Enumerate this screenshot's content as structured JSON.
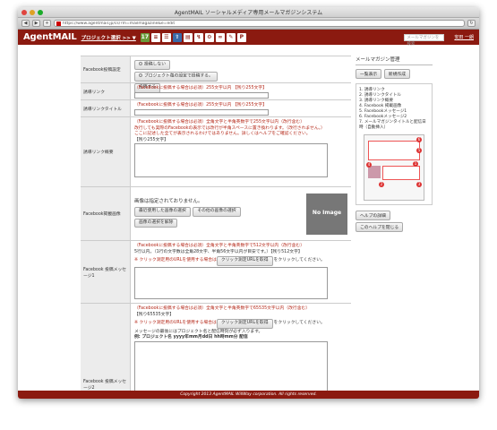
{
  "window": {
    "title": "AgentMAIL ソーシャルメディア専用メールマガジンシステム"
  },
  "browser": {
    "url": "https://www.agentmail.jp/cs/?m=mailmagazine&e=edit"
  },
  "header": {
    "logo": "AgentMAIL",
    "project_select": "プロジェクト選択 >> ▼",
    "icons": [
      "calendar-icon",
      "document-icon",
      "list-icon",
      "upload-icon",
      "book-icon",
      "pin-icon",
      "gear-icon",
      "link-icon",
      "tool-icon",
      "p-icon"
    ],
    "search_placeholder": "メールマガジンを検索",
    "user": "安田 一朗"
  },
  "form": {
    "fb_post": {
      "label": "Facebook投稿設定",
      "options": [
        "投稿しない",
        "プロジェクト毎の設定で投稿する。"
      ],
      "submit": "投稿する"
    },
    "link": {
      "label": "誘導リンク",
      "note": "（Facebookに投稿する場合は必須）255文字以内 【残り255文字】"
    },
    "link_title": {
      "label": "誘導リンクタイトル",
      "note": "（Facebookに投稿する場合は必須）255文字以内 【残り255文字】"
    },
    "link_summary": {
      "label": "誘導リンク概要",
      "note1": "（Facebookに投稿する場合は必須）全角文字と半角英数字で255文字以内（改行含む）",
      "note2": "改行しても実際のFacebookの表示では改行が半角スペースに置き換わります。（改行されません。）",
      "note3": "ここに記述した全てが表示されるわけではありません。詳しくはヘルプをご確認ください。",
      "remain": "【残り255文字】"
    },
    "image": {
      "label": "Facebook掲載画像",
      "status": "画像は指定されておりません。",
      "btn_recent": "最近使用した画像の選択",
      "btn_other": "その他の画像の選択",
      "btn_clear": "画像の選択を解除",
      "placeholder": "No Image"
    },
    "msg1": {
      "label": "Facebook 投稿メッセージ1",
      "note1": "（Facebookに投稿する場合は必須）全角文字と半角英数字で512文字以内（改行含む）",
      "note2": "5行以内。（1行の文字数は全角28文字、半角56文字以内が目安です。）【残り512文字】",
      "note3": "※ クリック測定用のURLを使用する場合は",
      "btn": "クリック測定URLを取得",
      "note4": "をクリックしてください。"
    },
    "msg2": {
      "label": "Facebook 投稿メッセージ2",
      "note1": "（Facebookに投稿する場合は必須）全角文字と半角英数字で65535文字以内（改行含む）",
      "remain": "【残り65535文字】",
      "note3": "※ クリック測定用のURLを使用する場合は",
      "btn": "クリック測定URLを取得",
      "note4": "をクリックしてください。",
      "note5": "メッセージの最後にはプロジェクト名と配信時刻が必ず入ります。",
      "example": "例: プロジェクト名 yyyy年mm月dd日 hh時mm分 配信"
    }
  },
  "side": {
    "title": "メールマガジン管理",
    "btn_list": "一覧表示",
    "btn_new": "新規作成",
    "help_items": [
      "1. 誘導リンク",
      "2. 誘導リンクタイトル",
      "3. 誘導リンク概要",
      "4. Facebook 掲載画像",
      "5. Facebookメッセージ1",
      "6. Facebookメッセージ2",
      "7. メールマガジンタイトルと配信日時（自動挿入）"
    ],
    "btn_help": "ヘルプの詳細",
    "btn_close": "このヘルプを閉じる"
  },
  "footer": {
    "copyright": "Copyright 2013 AgentMAIL WillWay corporation. All rights reserved."
  },
  "colors": {
    "brand": "#8b1a10",
    "note": "#b5291a"
  }
}
